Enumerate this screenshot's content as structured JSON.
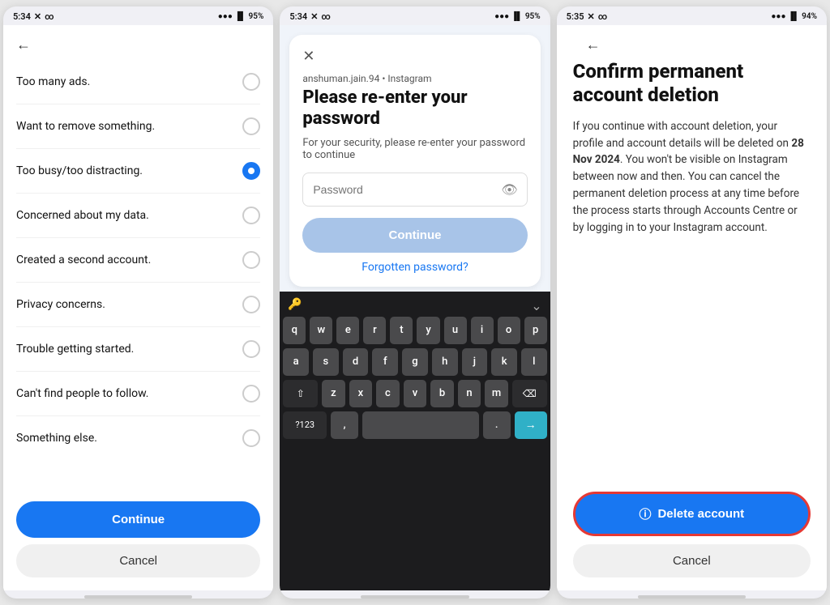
{
  "panel1": {
    "status_time": "5:34",
    "status_battery": "95%",
    "back_icon": "←",
    "reasons": [
      {
        "label": "Too many ads.",
        "selected": false
      },
      {
        "label": "Want to remove something.",
        "selected": false
      },
      {
        "label": "Too busy/too distracting.",
        "selected": true
      },
      {
        "label": "Concerned about my data.",
        "selected": false
      },
      {
        "label": "Created a second account.",
        "selected": false
      },
      {
        "label": "Privacy concerns.",
        "selected": false
      },
      {
        "label": "Trouble getting started.",
        "selected": false
      },
      {
        "label": "Can't find people to follow.",
        "selected": false
      },
      {
        "label": "Something else.",
        "selected": false
      }
    ],
    "continue_label": "Continue",
    "cancel_label": "Cancel"
  },
  "panel2": {
    "status_time": "5:34",
    "status_battery": "95%",
    "close_icon": "✕",
    "subtitle": "anshuman.jain.94 • Instagram",
    "title": "Please re-enter your password",
    "description": "For your security, please re-enter your password to continue",
    "password_placeholder": "Password",
    "continue_label": "Continue",
    "forgotten_label": "Forgotten password?",
    "keyboard_rows": [
      [
        "q",
        "w",
        "e",
        "r",
        "t",
        "y",
        "u",
        "i",
        "o",
        "p"
      ],
      [
        "a",
        "s",
        "d",
        "f",
        "g",
        "h",
        "j",
        "k",
        "l"
      ],
      [
        "z",
        "x",
        "c",
        "v",
        "b",
        "n",
        "m"
      ]
    ],
    "key_num": "?123",
    "key_delete": "⌫"
  },
  "panel3": {
    "status_time": "5:35",
    "status_battery": "94%",
    "back_icon": "←",
    "title": "Confirm permanent account deletion",
    "description_parts": {
      "before": "If you continue with account deletion, your profile and account details will be deleted on ",
      "date": "28 Nov 2024",
      "after": ". You won't be visible on Instagram between now and then. You can cancel the permanent deletion process at any time before the process starts through Accounts Centre or by logging in to your Instagram account."
    },
    "delete_icon": "ⓘ",
    "delete_label": "Delete account",
    "cancel_label": "Cancel"
  }
}
